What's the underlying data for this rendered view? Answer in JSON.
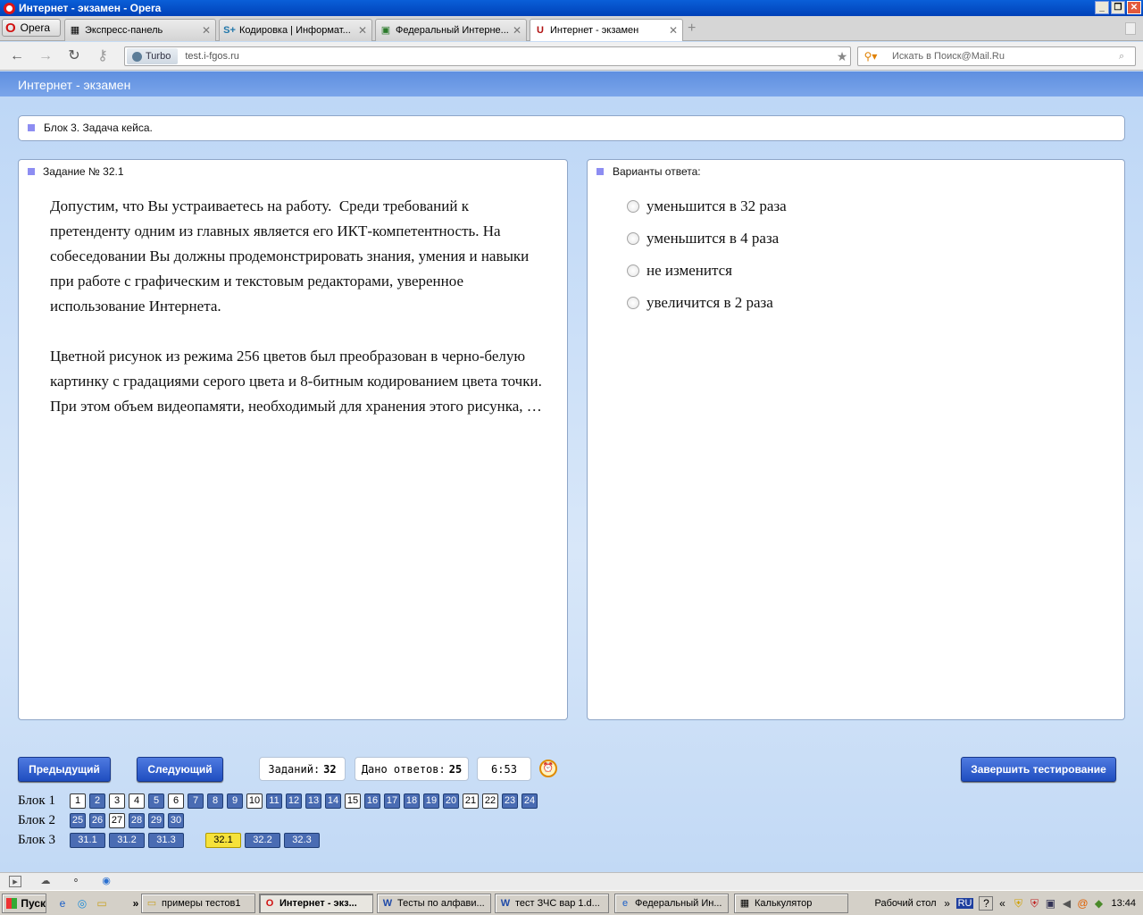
{
  "window": {
    "title": "Интернет - экзамен - Opera"
  },
  "browser": {
    "menu_label": "Opera",
    "tabs": [
      {
        "label": "Экспресс-панель",
        "icon": "grid-icon"
      },
      {
        "label": "Кодировка | Информат...",
        "icon": "plus-icon"
      },
      {
        "label": "Федеральный Интерне...",
        "icon": "site-icon"
      },
      {
        "label": "Интернет - экзамен",
        "icon": "site-icon"
      }
    ],
    "turbo_label": "Turbo",
    "url": "test.i-fgos.ru",
    "search_placeholder": "Искать в Поиск@Mail.Ru"
  },
  "page": {
    "header_title": "Интернет - экзамен",
    "block_title": "Блок 3. Задача кейса.",
    "task": {
      "title": "Задание № 32.1",
      "text": "Допустим, что Вы устраиваетесь на работу.  Среди требований к претенденту одним из главных является его ИКТ-компетентность. На собеседовании Вы должны продемонстрировать знания, умения и навыки при работе с графическим и текстовым редакторами, уверенное использование Интернета.\n\nЦветной рисунок из режима 256 цветов был преобразован в черно-белую картинку с градациями серого цвета и 8-битным кодированием цвета точки. При этом объем видеопамяти, необходимый для хранения этого рисунка, …"
    },
    "answers": {
      "title": "Варианты ответа:",
      "options": [
        "уменьшится в 32 раза",
        "уменьшится в 4 раза",
        "не изменится",
        "увеличится в 2 раза"
      ]
    },
    "controls": {
      "prev": "Предыдущий",
      "next": "Следующий",
      "tasks_label": "Заданий:",
      "tasks_value": "32",
      "answers_label": "Дано ответов:",
      "answers_value": "25",
      "timer": "6:53",
      "finish": "Завершить тестирование"
    },
    "blocks": [
      {
        "label": "Блок 1",
        "items": [
          {
            "n": "1",
            "s": "answered"
          },
          {
            "n": "2",
            "s": "open"
          },
          {
            "n": "3",
            "s": "answered"
          },
          {
            "n": "4",
            "s": "answered"
          },
          {
            "n": "5",
            "s": "open"
          },
          {
            "n": "6",
            "s": "answered"
          },
          {
            "n": "7",
            "s": "open"
          },
          {
            "n": "8",
            "s": "open"
          },
          {
            "n": "9",
            "s": "open"
          },
          {
            "n": "10",
            "s": "answered"
          },
          {
            "n": "11",
            "s": "open"
          },
          {
            "n": "12",
            "s": "open"
          },
          {
            "n": "13",
            "s": "open"
          },
          {
            "n": "14",
            "s": "open"
          },
          {
            "n": "15",
            "s": "answered"
          },
          {
            "n": "16",
            "s": "open"
          },
          {
            "n": "17",
            "s": "open"
          },
          {
            "n": "18",
            "s": "open"
          },
          {
            "n": "19",
            "s": "open"
          },
          {
            "n": "20",
            "s": "open"
          },
          {
            "n": "21",
            "s": "answered"
          },
          {
            "n": "22",
            "s": "answered"
          },
          {
            "n": "23",
            "s": "open"
          },
          {
            "n": "24",
            "s": "open"
          }
        ]
      },
      {
        "label": "Блок 2",
        "items": [
          {
            "n": "25",
            "s": "open"
          },
          {
            "n": "26",
            "s": "open"
          },
          {
            "n": "27",
            "s": "answered"
          },
          {
            "n": "28",
            "s": "open"
          },
          {
            "n": "29",
            "s": "open"
          },
          {
            "n": "30",
            "s": "open"
          }
        ]
      },
      {
        "label": "Блок 3",
        "items": [
          {
            "n": "31.1",
            "s": "open"
          },
          {
            "n": "31.2",
            "s": "open"
          },
          {
            "n": "31.3",
            "s": "open"
          },
          {
            "n": "32.1",
            "s": "current"
          },
          {
            "n": "32.2",
            "s": "open"
          },
          {
            "n": "32.3",
            "s": "open"
          }
        ]
      }
    ]
  },
  "taskbar": {
    "start": "Пуск",
    "buttons": [
      {
        "label": "примеры тестов1",
        "icon": "folder-icon"
      },
      {
        "label": "Интернет - экз...",
        "icon": "opera-icon"
      },
      {
        "label": "Тесты по алфави...",
        "icon": "word-icon"
      },
      {
        "label": "тест ЗЧС вар 1.d...",
        "icon": "word-icon"
      },
      {
        "label": "Федеральный Ин...",
        "icon": "ie-icon"
      },
      {
        "label": "Калькулятор",
        "icon": "calculator-icon"
      }
    ],
    "desktop_label": "Рабочий стол",
    "lang": "RU",
    "clock": "13:44"
  }
}
